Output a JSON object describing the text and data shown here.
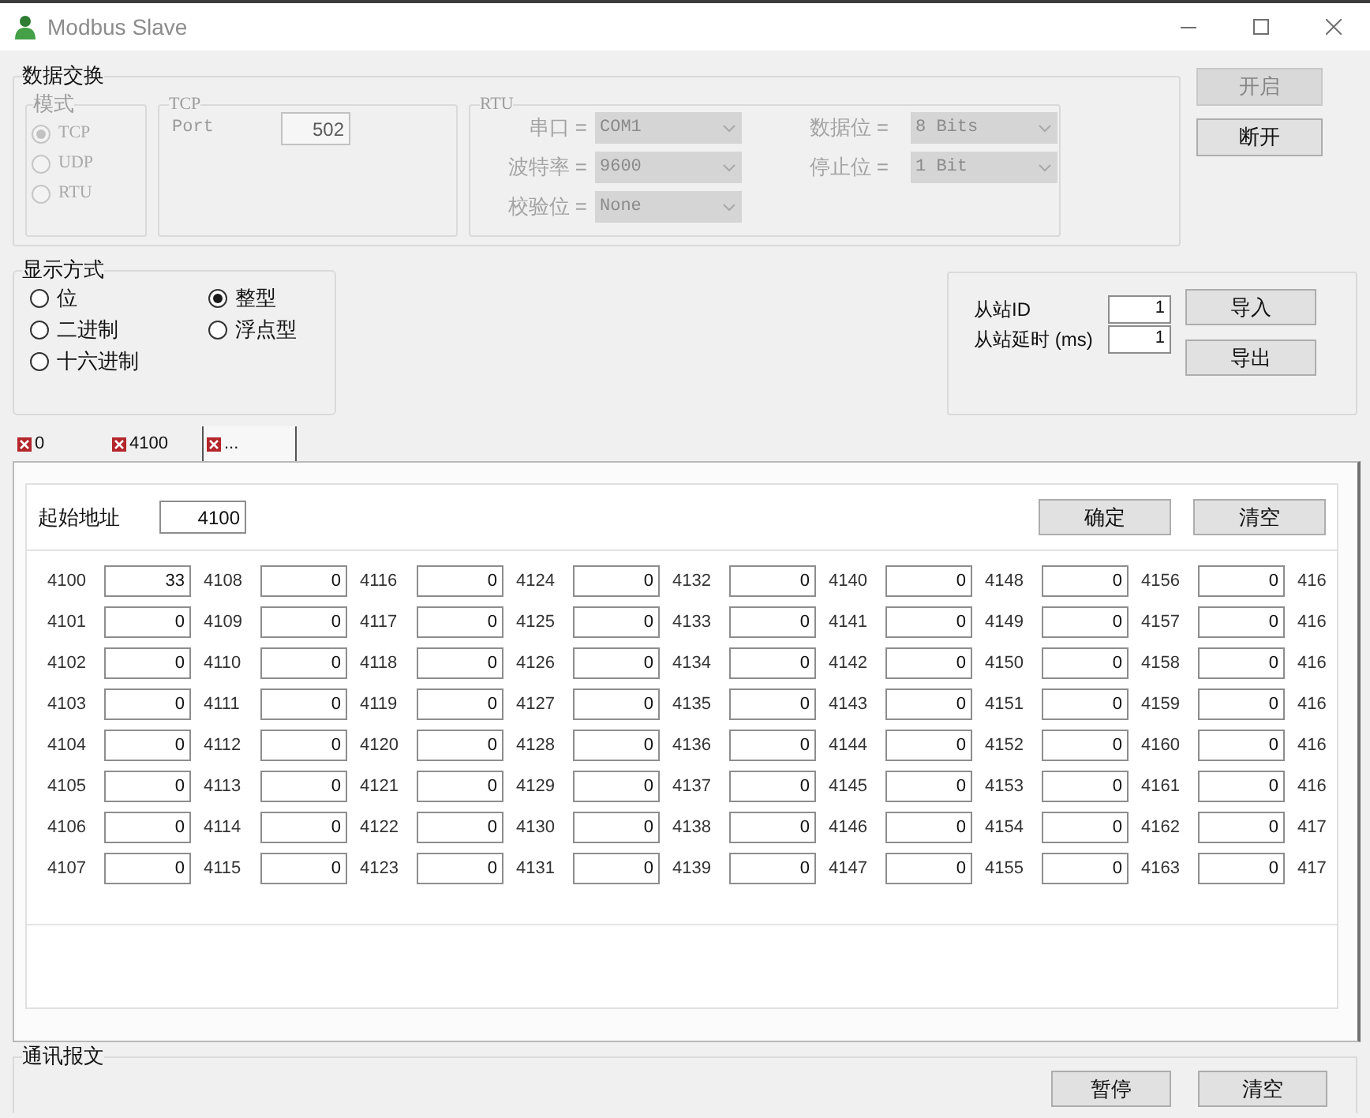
{
  "window": {
    "title": "Modbus Slave"
  },
  "data_exchange": {
    "title": "数据交换",
    "mode": {
      "title": "模式",
      "disabled": true,
      "options": [
        {
          "label": "TCP",
          "selected": true
        },
        {
          "label": "UDP",
          "selected": false
        },
        {
          "label": "RTU",
          "selected": false
        }
      ]
    },
    "tcp": {
      "title": "TCP",
      "disabled": true,
      "port_label": "Port",
      "port_value": "502"
    },
    "rtu": {
      "title": "RTU",
      "disabled": true,
      "columns": [
        [
          {
            "label": "串口 =",
            "value": "COM1"
          },
          {
            "label": "波特率 =",
            "value": "9600"
          },
          {
            "label": "校验位 =",
            "value": "None"
          }
        ],
        [
          {
            "label": "数据位 =",
            "value": "8 Bits"
          },
          {
            "label": "停止位 =",
            "value": "1 Bit"
          }
        ]
      ]
    }
  },
  "connection_buttons": [
    {
      "label": "开启",
      "disabled": true
    },
    {
      "label": "断开",
      "disabled": false
    }
  ],
  "display_mode": {
    "title": "显示方式",
    "columns": [
      [
        {
          "label": "位",
          "selected": false
        },
        {
          "label": "二进制",
          "selected": false
        },
        {
          "label": "十六进制",
          "selected": false
        }
      ],
      [
        {
          "label": "整型",
          "selected": true
        },
        {
          "label": "浮点型",
          "selected": false
        }
      ]
    ]
  },
  "slave": {
    "fields": [
      {
        "label": "从站ID",
        "value": "1"
      },
      {
        "label": "从站延时 (ms)",
        "value": "1"
      }
    ],
    "buttons": [
      "导入",
      "导出"
    ]
  },
  "tabs": [
    {
      "label": "0",
      "selected": false
    },
    {
      "label": "4100",
      "selected": false
    },
    {
      "label": "...",
      "selected": true
    }
  ],
  "registers": {
    "start_label": "起始地址",
    "start_value": "4100",
    "buttons": [
      "确定",
      "清空"
    ],
    "columns": [
      [
        {
          "address": "4100",
          "value": "33"
        },
        {
          "address": "4101",
          "value": "0"
        },
        {
          "address": "4102",
          "value": "0"
        },
        {
          "address": "4103",
          "value": "0"
        },
        {
          "address": "4104",
          "value": "0"
        },
        {
          "address": "4105",
          "value": "0"
        },
        {
          "address": "4106",
          "value": "0"
        },
        {
          "address": "4107",
          "value": "0"
        }
      ],
      [
        {
          "address": "4108",
          "value": "0"
        },
        {
          "address": "4109",
          "value": "0"
        },
        {
          "address": "4110",
          "value": "0"
        },
        {
          "address": "4111",
          "value": "0"
        },
        {
          "address": "4112",
          "value": "0"
        },
        {
          "address": "4113",
          "value": "0"
        },
        {
          "address": "4114",
          "value": "0"
        },
        {
          "address": "4115",
          "value": "0"
        }
      ],
      [
        {
          "address": "4116",
          "value": "0"
        },
        {
          "address": "4117",
          "value": "0"
        },
        {
          "address": "4118",
          "value": "0"
        },
        {
          "address": "4119",
          "value": "0"
        },
        {
          "address": "4120",
          "value": "0"
        },
        {
          "address": "4121",
          "value": "0"
        },
        {
          "address": "4122",
          "value": "0"
        },
        {
          "address": "4123",
          "value": "0"
        }
      ],
      [
        {
          "address": "4124",
          "value": "0"
        },
        {
          "address": "4125",
          "value": "0"
        },
        {
          "address": "4126",
          "value": "0"
        },
        {
          "address": "4127",
          "value": "0"
        },
        {
          "address": "4128",
          "value": "0"
        },
        {
          "address": "4129",
          "value": "0"
        },
        {
          "address": "4130",
          "value": "0"
        },
        {
          "address": "4131",
          "value": "0"
        }
      ],
      [
        {
          "address": "4132",
          "value": "0"
        },
        {
          "address": "4133",
          "value": "0"
        },
        {
          "address": "4134",
          "value": "0"
        },
        {
          "address": "4135",
          "value": "0"
        },
        {
          "address": "4136",
          "value": "0"
        },
        {
          "address": "4137",
          "value": "0"
        },
        {
          "address": "4138",
          "value": "0"
        },
        {
          "address": "4139",
          "value": "0"
        }
      ],
      [
        {
          "address": "4140",
          "value": "0"
        },
        {
          "address": "4141",
          "value": "0"
        },
        {
          "address": "4142",
          "value": "0"
        },
        {
          "address": "4143",
          "value": "0"
        },
        {
          "address": "4144",
          "value": "0"
        },
        {
          "address": "4145",
          "value": "0"
        },
        {
          "address": "4146",
          "value": "0"
        },
        {
          "address": "4147",
          "value": "0"
        }
      ],
      [
        {
          "address": "4148",
          "value": "0"
        },
        {
          "address": "4149",
          "value": "0"
        },
        {
          "address": "4150",
          "value": "0"
        },
        {
          "address": "4151",
          "value": "0"
        },
        {
          "address": "4152",
          "value": "0"
        },
        {
          "address": "4153",
          "value": "0"
        },
        {
          "address": "4154",
          "value": "0"
        },
        {
          "address": "4155",
          "value": "0"
        }
      ],
      [
        {
          "address": "4156",
          "value": "0"
        },
        {
          "address": "4157",
          "value": "0"
        },
        {
          "address": "4158",
          "value": "0"
        },
        {
          "address": "4159",
          "value": "0"
        },
        {
          "address": "4160",
          "value": "0"
        },
        {
          "address": "4161",
          "value": "0"
        },
        {
          "address": "4162",
          "value": "0"
        },
        {
          "address": "4163",
          "value": "0"
        }
      ],
      [
        {
          "address": "416"
        },
        {
          "address": "416"
        },
        {
          "address": "416"
        },
        {
          "address": "416"
        },
        {
          "address": "416"
        },
        {
          "address": "416"
        },
        {
          "address": "417"
        },
        {
          "address": "417"
        }
      ]
    ]
  },
  "message_log": {
    "title": "通讯报文",
    "buttons": [
      "暂停",
      "清空"
    ]
  }
}
